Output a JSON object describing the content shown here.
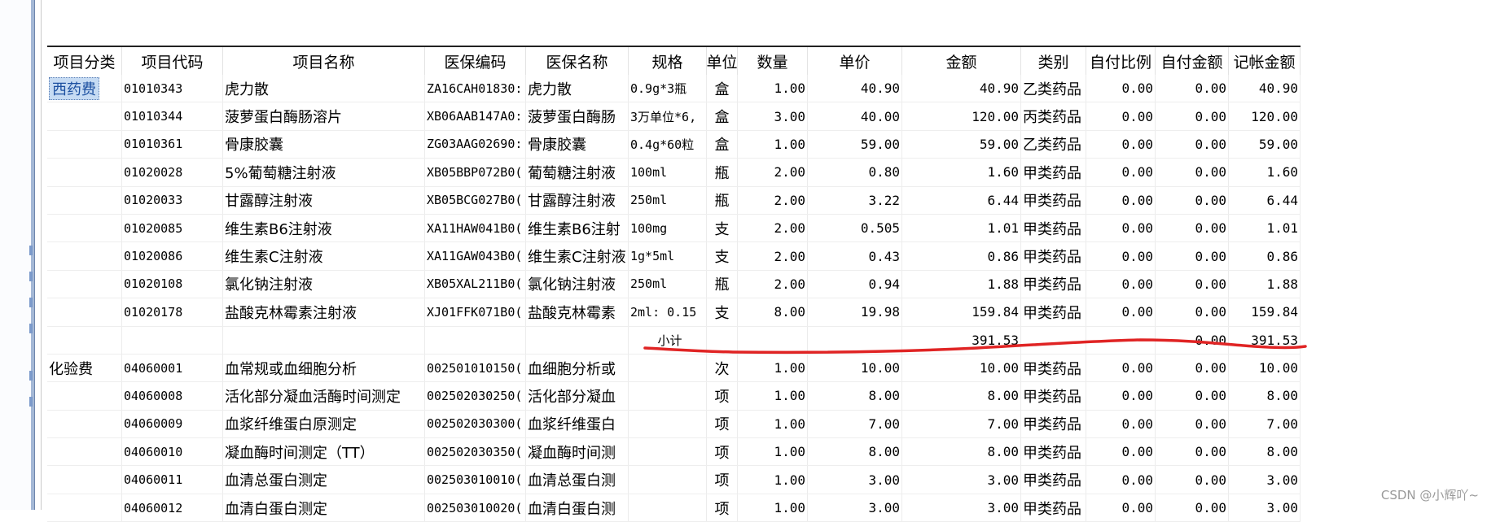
{
  "columns": [
    "项目分类",
    "项目代码",
    "项目名称",
    "医保编码",
    "医保名称",
    "规格",
    "单位",
    "数量",
    "单价",
    "金额",
    "类别",
    "自付比例",
    "自付金额",
    "记帐金额"
  ],
  "rows": [
    {
      "cat": "西药费",
      "code": "01010343",
      "name": "虎力散",
      "ins_code": "ZA16CAH01830:",
      "ins_name": "虎力散",
      "spec": "0.9g*3瓶",
      "unit": "盒",
      "qty": "1.00",
      "price": "40.90",
      "amount": "40.90",
      "class": "乙类药品",
      "self_ratio": "0.00",
      "self_amount": "0.00",
      "account": "40.90"
    },
    {
      "cat": "",
      "code": "01010344",
      "name": "菠萝蛋白酶肠溶片",
      "ins_code": "XB06AAB147A0:",
      "ins_name": "菠萝蛋白酶肠",
      "spec": "3万单位*6,",
      "unit": "盒",
      "qty": "3.00",
      "price": "40.00",
      "amount": "120.00",
      "class": "丙类药品",
      "self_ratio": "0.00",
      "self_amount": "0.00",
      "account": "120.00"
    },
    {
      "cat": "",
      "code": "01010361",
      "name": "骨康胶囊",
      "ins_code": "ZG03AAG02690:",
      "ins_name": "骨康胶囊",
      "spec": "0.4g*60粒",
      "unit": "盒",
      "qty": "1.00",
      "price": "59.00",
      "amount": "59.00",
      "class": "乙类药品",
      "self_ratio": "0.00",
      "self_amount": "0.00",
      "account": "59.00"
    },
    {
      "cat": "",
      "code": "01020028",
      "name": "5%葡萄糖注射液",
      "ins_code": "XB05BBP072B0(",
      "ins_name": "葡萄糖注射液",
      "spec": "100ml",
      "unit": "瓶",
      "qty": "2.00",
      "price": "0.80",
      "amount": "1.60",
      "class": "甲类药品",
      "self_ratio": "0.00",
      "self_amount": "0.00",
      "account": "1.60"
    },
    {
      "cat": "",
      "code": "01020033",
      "name": "甘露醇注射液",
      "ins_code": "XB05BCG027B0(",
      "ins_name": "甘露醇注射液",
      "spec": "250ml",
      "unit": "瓶",
      "qty": "2.00",
      "price": "3.22",
      "amount": "6.44",
      "class": "甲类药品",
      "self_ratio": "0.00",
      "self_amount": "0.00",
      "account": "6.44"
    },
    {
      "cat": "",
      "code": "01020085",
      "name": "维生素B6注射液",
      "ins_code": "XA11HAW041B0(",
      "ins_name": "维生素B6注射",
      "spec": "100mg",
      "unit": "支",
      "qty": "2.00",
      "price": "0.505",
      "amount": "1.01",
      "class": "甲类药品",
      "self_ratio": "0.00",
      "self_amount": "0.00",
      "account": "1.01"
    },
    {
      "cat": "",
      "code": "01020086",
      "name": "维生素C注射液",
      "ins_code": "XA11GAW043B0(",
      "ins_name": "维生素C注射液",
      "spec": "1g*5ml",
      "unit": "支",
      "qty": "2.00",
      "price": "0.43",
      "amount": "0.86",
      "class": "甲类药品",
      "self_ratio": "0.00",
      "self_amount": "0.00",
      "account": "0.86"
    },
    {
      "cat": "",
      "code": "01020108",
      "name": "氯化钠注射液",
      "ins_code": "XB05XAL211B0(",
      "ins_name": "氯化钠注射液",
      "spec": "250ml",
      "unit": "瓶",
      "qty": "2.00",
      "price": "0.94",
      "amount": "1.88",
      "class": "甲类药品",
      "self_ratio": "0.00",
      "self_amount": "0.00",
      "account": "1.88"
    },
    {
      "cat": "",
      "code": "01020178",
      "name": "盐酸克林霉素注射液",
      "ins_code": "XJ01FFK071B0(",
      "ins_name": "盐酸克林霉素",
      "spec": "2ml: 0.15",
      "unit": "支",
      "qty": "8.00",
      "price": "19.98",
      "amount": "159.84",
      "class": "甲类药品",
      "self_ratio": "0.00",
      "self_amount": "0.00",
      "account": "159.84"
    },
    {
      "cat": "",
      "code": "",
      "name": "",
      "ins_code": "",
      "ins_name": "",
      "spec": "小计",
      "unit": "",
      "qty": "",
      "price": "",
      "amount": "391.53",
      "class": "",
      "self_ratio": "",
      "self_amount": "0.00",
      "account": "391.53"
    },
    {
      "cat": "化验费",
      "code": "04060001",
      "name": "血常规或血细胞分析",
      "ins_code": "002501010150(",
      "ins_name": "血细胞分析或",
      "spec": "",
      "unit": "次",
      "qty": "1.00",
      "price": "10.00",
      "amount": "10.00",
      "class": "甲类药品",
      "self_ratio": "0.00",
      "self_amount": "0.00",
      "account": "10.00"
    },
    {
      "cat": "",
      "code": "04060008",
      "name": "活化部分凝血活酶时间测定",
      "ins_code": "002502030250(",
      "ins_name": "活化部分凝血",
      "spec": "",
      "unit": "项",
      "qty": "1.00",
      "price": "8.00",
      "amount": "8.00",
      "class": "甲类药品",
      "self_ratio": "0.00",
      "self_amount": "0.00",
      "account": "8.00"
    },
    {
      "cat": "",
      "code": "04060009",
      "name": "血浆纤维蛋白原测定",
      "ins_code": "002502030300(",
      "ins_name": "血浆纤维蛋白",
      "spec": "",
      "unit": "项",
      "qty": "1.00",
      "price": "7.00",
      "amount": "7.00",
      "class": "甲类药品",
      "self_ratio": "0.00",
      "self_amount": "0.00",
      "account": "7.00"
    },
    {
      "cat": "",
      "code": "04060010",
      "name": "凝血酶时间测定（TT）",
      "ins_code": "002502030350(",
      "ins_name": "凝血酶时间测",
      "spec": "",
      "unit": "项",
      "qty": "1.00",
      "price": "8.00",
      "amount": "8.00",
      "class": "甲类药品",
      "self_ratio": "0.00",
      "self_amount": "0.00",
      "account": "8.00"
    },
    {
      "cat": "",
      "code": "04060011",
      "name": "血清总蛋白测定",
      "ins_code": "002503010010(",
      "ins_name": "血清总蛋白测",
      "spec": "",
      "unit": "项",
      "qty": "1.00",
      "price": "3.00",
      "amount": "3.00",
      "class": "甲类药品",
      "self_ratio": "0.00",
      "self_amount": "0.00",
      "account": "3.00"
    },
    {
      "cat": "",
      "code": "04060012",
      "name": "血清白蛋白测定",
      "ins_code": "002503010020(",
      "ins_name": "血清白蛋白测",
      "spec": "",
      "unit": "项",
      "qty": "1.00",
      "price": "3.00",
      "amount": "3.00",
      "class": "甲类药品",
      "self_ratio": "0.00",
      "self_amount": "0.00",
      "account": "3.00"
    }
  ],
  "watermark": "CSDN @小辉吖~",
  "colors": {
    "annotation": "#e02424",
    "selection": "#c6dbf3",
    "gutter": "#a4b8d6"
  }
}
